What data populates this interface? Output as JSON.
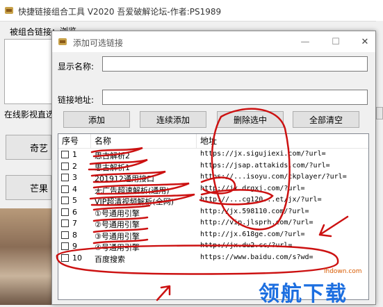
{
  "main": {
    "title": "快捷链接组合工具 V2020   吾爱破解论坛-作者:PS1989",
    "label_combined": "被组合链接：",
    "browse": "浏览",
    "label_online": "在线影视直选",
    "btn1": "奇艺",
    "btn2": "芒果"
  },
  "dialog": {
    "title": "添加可选链接",
    "minimize": "—",
    "maximize": "☐",
    "close": "✕",
    "label_name": "显示名称:",
    "label_url": "链接地址:",
    "name_value": "",
    "url_value": "",
    "buttons": {
      "add": "添加",
      "continuous_add": "连续添加",
      "delete_selected": "删除选中",
      "clear_all": "全部清空"
    },
    "columns": {
      "no": "序号",
      "name": "名称",
      "url": "地址"
    },
    "rows": [
      {
        "no": "1",
        "name": "思古解析2",
        "url": "https://jx.sigujiexi.com/?url="
      },
      {
        "no": "2",
        "name": "思古解析1",
        "url": "https://jsap.attakids.com/?url="
      },
      {
        "no": "3",
        "name": "201912通用接口",
        "url": "https://...isoyu.com/ckplayer/?url="
      },
      {
        "no": "4",
        "name": "无广告超速解析(通用)",
        "url": "http://jx.drgxj.com/?url="
      },
      {
        "no": "5",
        "name": "VIP超清视频解析(全网)",
        "url": "http://...cg120...et/jx/?url="
      },
      {
        "no": "6",
        "name": "①号通用引擎",
        "url": "http://jx.598110.com/?url="
      },
      {
        "no": "7",
        "name": "②号通用引擎",
        "url": "http://vip.jlsprh.com/?url="
      },
      {
        "no": "8",
        "name": "③号通用引擎",
        "url": "http://jx.618ge.com/?url="
      },
      {
        "no": "9",
        "name": "④号通用引擎",
        "url": "http://jx.du2.cc/?url="
      },
      {
        "no": "10",
        "name": "百度搜索",
        "url": "https://www.baidu.com/s?wd="
      }
    ]
  },
  "watermark": {
    "small": "lhdown.com",
    "big": "领航下载"
  },
  "colors": {
    "annotation": "#cc1111",
    "watermark_blue": "#1d6fe0"
  }
}
